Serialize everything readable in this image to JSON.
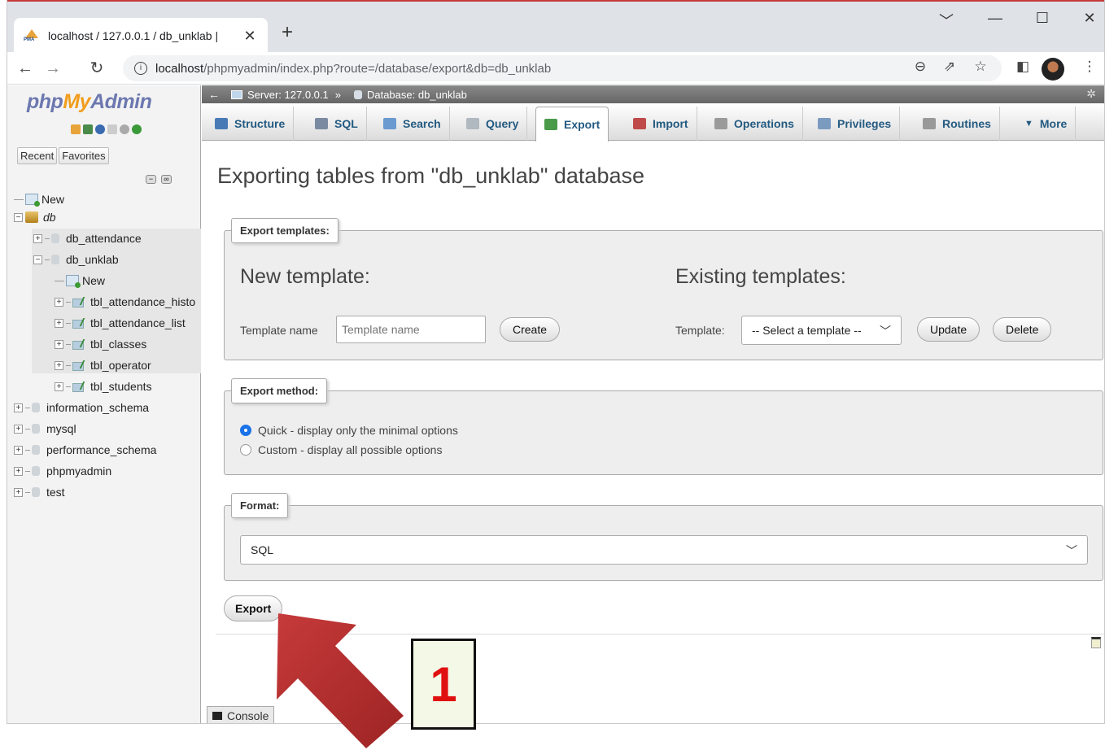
{
  "browser": {
    "tab_title": "localhost / 127.0.0.1 / db_unklab |",
    "tab_close": "✕",
    "new_tab": "+",
    "url_host": "localhost",
    "url_rest": "/phpmyadmin/index.php?route=/database/export&db=db_unklab",
    "info": "i",
    "window_controls": [
      "﹀",
      "—",
      "☐",
      "✕"
    ]
  },
  "sidebar": {
    "logo_php": "php",
    "logo_my": "My",
    "logo_admin": "Admin",
    "recent": "Recent",
    "favorites": "Favorites",
    "tree": [
      {
        "label": "New",
        "level": 0,
        "type": "new"
      },
      {
        "label": "db",
        "level": 0,
        "type": "group",
        "italic": true
      },
      {
        "label": "db_attendance",
        "level": 1,
        "type": "db"
      },
      {
        "label": "db_unklab",
        "level": 1,
        "type": "db"
      },
      {
        "label": "New",
        "level": 2,
        "type": "new"
      },
      {
        "label": "tbl_attendance_histo",
        "level": 2,
        "type": "table"
      },
      {
        "label": "tbl_attendance_list",
        "level": 2,
        "type": "table"
      },
      {
        "label": "tbl_classes",
        "level": 2,
        "type": "table"
      },
      {
        "label": "tbl_operator",
        "level": 2,
        "type": "table"
      },
      {
        "label": "tbl_students",
        "level": 2,
        "type": "table"
      },
      {
        "label": "information_schema",
        "level": 0,
        "type": "db"
      },
      {
        "label": "mysql",
        "level": 0,
        "type": "db"
      },
      {
        "label": "performance_schema",
        "level": 0,
        "type": "db"
      },
      {
        "label": "phpmyadmin",
        "level": 0,
        "type": "db"
      },
      {
        "label": "test",
        "level": 0,
        "type": "db"
      }
    ]
  },
  "breadcrumb": {
    "server": "Server: 127.0.0.1",
    "separator": "»",
    "database": "Database: db_unklab"
  },
  "menu": {
    "tabs": [
      {
        "label": "Structure",
        "color": "#4a7ab5"
      },
      {
        "label": "SQL",
        "color": "#7a8aa0"
      },
      {
        "label": "Search",
        "color": "#6a9ad0"
      },
      {
        "label": "Query",
        "color": "#b0b8c0"
      },
      {
        "label": "Export",
        "color": "#4a9a4a",
        "active": true
      },
      {
        "label": "Import",
        "color": "#c04a4a"
      },
      {
        "label": "Operations",
        "color": "#9a9a9a"
      },
      {
        "label": "Privileges",
        "color": "#7a9ac0"
      },
      {
        "label": "Routines",
        "color": "#999999"
      },
      {
        "label": "More",
        "color": "#333333"
      }
    ]
  },
  "page": {
    "title": "Exporting tables from \"db_unklab\" database"
  },
  "templates": {
    "legend": "Export templates:",
    "new_heading": "New template:",
    "existing_heading": "Existing templates:",
    "name_label": "Template name",
    "name_placeholder": "Template name",
    "create": "Create",
    "template_label": "Template:",
    "select_value": "-- Select a template --",
    "update": "Update",
    "delete": "Delete"
  },
  "method": {
    "legend": "Export method:",
    "quick": "Quick - display only the minimal options",
    "custom": "Custom - display all possible options",
    "selected": "quick"
  },
  "format": {
    "legend": "Format:",
    "value": "SQL"
  },
  "actions": {
    "export": "Export",
    "console": "Console"
  },
  "annotation": {
    "number": "1",
    "arrow_color": "#b52a2a"
  }
}
